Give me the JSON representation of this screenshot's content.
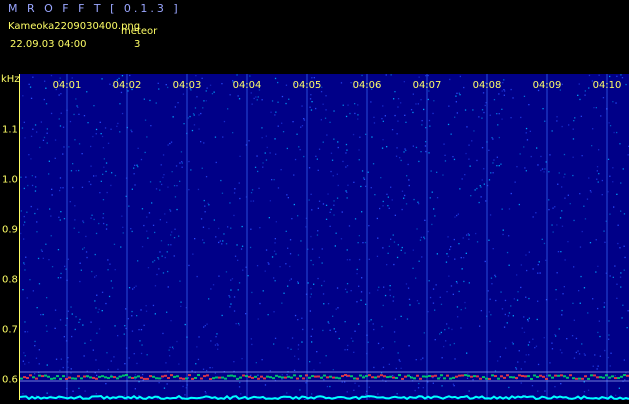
{
  "header": {
    "app_title": "M R O F F T  [ 0.1.3 ]",
    "file_name": "Kameoka2209030400.png",
    "meteor_label": "meteor",
    "datetime": "22.09.03 04:00",
    "meteor_count": "3"
  },
  "axis": {
    "unit_label": "kHz",
    "time_ticks": [
      "04:01",
      "04:02",
      "04:03",
      "04:04",
      "04:05",
      "04:06",
      "04:07",
      "04:08",
      "04:09",
      "04:10"
    ],
    "freq_ticks": [
      "1.1",
      "1.0",
      "0.9",
      "0.8",
      "0.7",
      "0.6"
    ]
  },
  "colors": {
    "background": "#000088",
    "text": "#ffff66",
    "title": "#9aa6ff",
    "trace": "#00ffff",
    "band": "#ff4040"
  }
}
